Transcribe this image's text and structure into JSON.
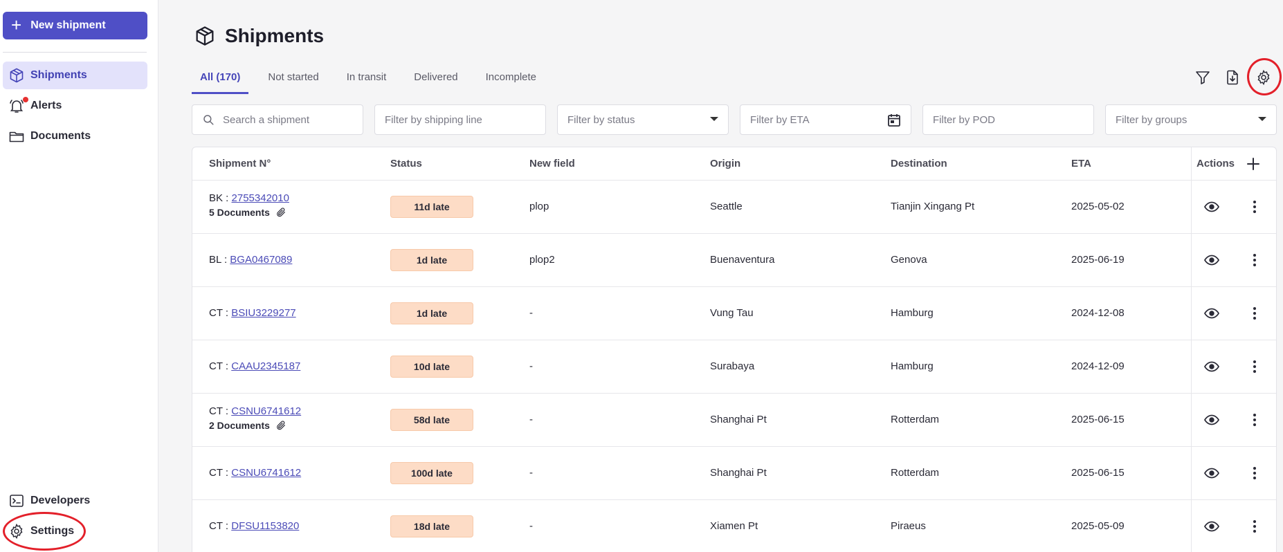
{
  "sidebar": {
    "new_button": "New shipment",
    "items": [
      {
        "label": "Shipments",
        "icon": "box-icon",
        "active": true
      },
      {
        "label": "Alerts",
        "icon": "bell-icon",
        "active": false
      },
      {
        "label": "Documents",
        "icon": "folder-icon",
        "active": false
      }
    ],
    "bottom_items": [
      {
        "label": "Developers",
        "icon": "terminal-icon"
      },
      {
        "label": "Settings",
        "icon": "gear-icon"
      }
    ]
  },
  "header": {
    "title": "Shipments",
    "icon": "box-icon"
  },
  "tabs": [
    {
      "label": "All (170)",
      "active": true
    },
    {
      "label": "Not started",
      "active": false
    },
    {
      "label": "In transit",
      "active": false
    },
    {
      "label": "Delivered",
      "active": false
    },
    {
      "label": "Incomplete",
      "active": false
    }
  ],
  "toolbar": {
    "icons": [
      "filter-icon",
      "export-icon",
      "settings-icon"
    ]
  },
  "filters": {
    "search": "Search a shipment",
    "shipping_line": "Filter by shipping line",
    "status": "Filter by status",
    "eta": "Filter by ETA",
    "pod": "Filter by POD",
    "groups": "Filter by groups"
  },
  "table": {
    "columns": {
      "shipment": "Shipment N°",
      "status": "Status",
      "new_field": "New field",
      "origin": "Origin",
      "destination": "Destination",
      "eta": "ETA",
      "actions": "Actions"
    },
    "rows": [
      {
        "prefix": "BK :",
        "number": "2755342010",
        "docs": "5 Documents",
        "status": "11d late",
        "new_field": "plop",
        "origin": "Seattle",
        "destination": "Tianjin Xingang Pt",
        "eta": "2025-05-02"
      },
      {
        "prefix": "BL :",
        "number": "BGA0467089",
        "docs": "",
        "status": "1d late",
        "new_field": "plop2",
        "origin": "Buenaventura",
        "destination": "Genova",
        "eta": "2025-06-19"
      },
      {
        "prefix": "CT :",
        "number": "BSIU3229277",
        "docs": "",
        "status": "1d late",
        "new_field": "-",
        "origin": "Vung Tau",
        "destination": "Hamburg",
        "eta": "2024-12-08"
      },
      {
        "prefix": "CT :",
        "number": "CAAU2345187",
        "docs": "",
        "status": "10d late",
        "new_field": "-",
        "origin": "Surabaya",
        "destination": "Hamburg",
        "eta": "2024-12-09"
      },
      {
        "prefix": "CT :",
        "number": "CSNU6741612",
        "docs": "2 Documents",
        "status": "58d late",
        "new_field": "-",
        "origin": "Shanghai Pt",
        "destination": "Rotterdam",
        "eta": "2025-06-15"
      },
      {
        "prefix": "CT :",
        "number": "CSNU6741612",
        "docs": "",
        "status": "100d late",
        "new_field": "-",
        "origin": "Shanghai Pt",
        "destination": "Rotterdam",
        "eta": "2025-06-15"
      },
      {
        "prefix": "CT :",
        "number": "DFSU1153820",
        "docs": "",
        "status": "18d late",
        "new_field": "-",
        "origin": "Xiamen Pt",
        "destination": "Piraeus",
        "eta": "2025-05-09"
      }
    ]
  },
  "colors": {
    "accent": "#4f4fc6",
    "badge_bg": "#fddcc6",
    "highlight_circle": "#e3202a"
  }
}
